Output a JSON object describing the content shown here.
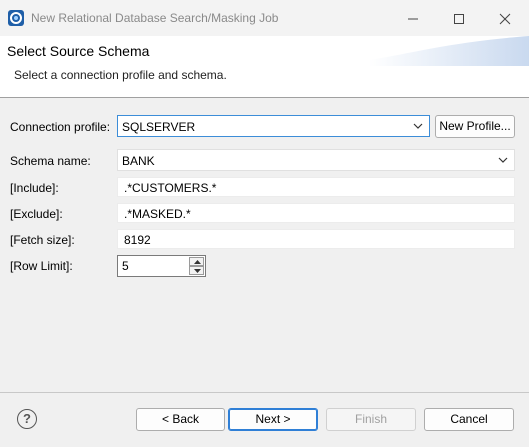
{
  "window": {
    "title": "New Relational Database Search/Masking Job",
    "icon": "app-logo-icon"
  },
  "banner": {
    "title": "Select Source Schema",
    "description": "Select a connection profile and schema."
  },
  "form": {
    "connection_profile": {
      "label": "Connection profile:",
      "value": "SQLSERVER"
    },
    "new_profile_label": "New Profile...",
    "schema_name": {
      "label": "Schema name:",
      "value": "BANK"
    },
    "include": {
      "label": "[Include]:",
      "value": ".*CUSTOMERS.*"
    },
    "exclude": {
      "label": "[Exclude]:",
      "value": ".*MASKED.*"
    },
    "fetch_size": {
      "label": "[Fetch size]:",
      "value": "8192"
    },
    "row_limit": {
      "label": "[Row Limit]:",
      "value": "5"
    }
  },
  "footer": {
    "help_glyph": "?",
    "back_label": "< Back",
    "next_label": "Next >",
    "finish_label": "Finish",
    "cancel_label": "Cancel"
  },
  "colors": {
    "accent": "#2f7fd6",
    "content_bg": "#f0f0f0",
    "banner_gradient": "#c9d9ef"
  }
}
